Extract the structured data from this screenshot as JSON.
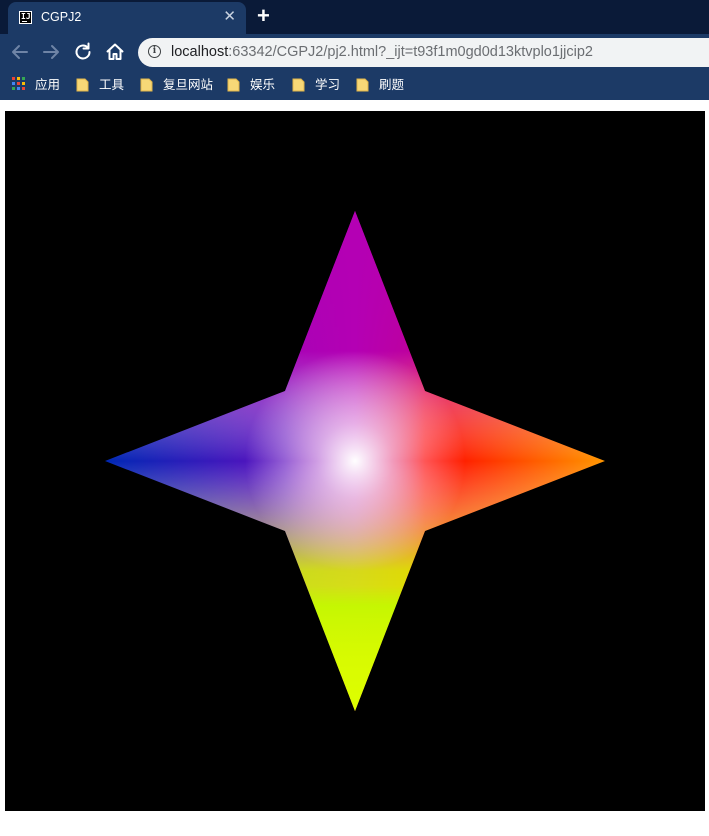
{
  "browser": {
    "tab": {
      "title": "CGPJ2",
      "favicon_icon": "intellij-icon",
      "favicon_text": "IJ"
    },
    "new_tab_icon": "plus-icon",
    "nav": {
      "back_icon": "arrow-left-icon",
      "forward_icon": "arrow-right-icon",
      "reload_icon": "reload-icon",
      "home_icon": "home-icon"
    },
    "address": {
      "host": "localhost",
      "path": ":63342/CGPJ2/pj2.html?_ijt=t93f1m0gd0d13ktvplo1jjcip2"
    },
    "bookmarks": [
      {
        "label": "应用",
        "icon": "apps-grid-icon"
      },
      {
        "label": "工具",
        "icon": "folder-icon"
      },
      {
        "label": "复旦网站",
        "icon": "folder-icon"
      },
      {
        "label": "娱乐",
        "icon": "folder-icon"
      },
      {
        "label": "学习",
        "icon": "folder-icon"
      },
      {
        "label": "刷题",
        "icon": "folder-icon"
      }
    ]
  },
  "colors": {
    "tabstrip_bg": "#0a1a38",
    "toolbar_bg": "#1c3a66",
    "canvas_bg": "#000000",
    "star_top": "#b400b4",
    "star_right": "#ff9600",
    "star_bottom": "#dcff00",
    "star_left": "#0028b4",
    "star_upper_left": "#6010c0",
    "star_upper_right": "#ff0000",
    "star_lower_right": "#ffc800",
    "star_lower_left": "#00c800",
    "star_center": "#ffffff"
  }
}
